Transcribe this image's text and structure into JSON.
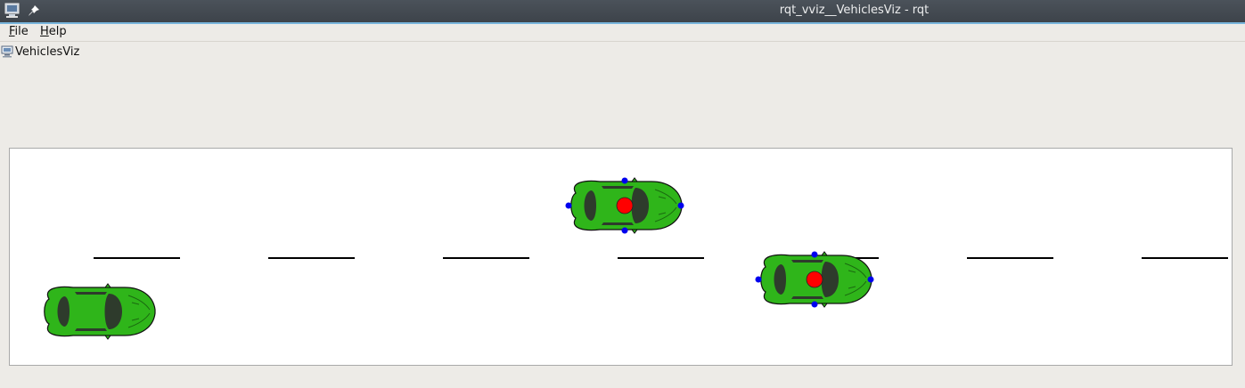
{
  "window": {
    "title": "rqt_vviz__VehiclesViz - rqt",
    "system_icon": "computer-icon",
    "pin_icon": "pin-icon"
  },
  "menu": {
    "items": [
      {
        "label": "File",
        "mnemonic": "F",
        "rest": "ile"
      },
      {
        "label": "Help",
        "mnemonic": "H",
        "rest": "elp"
      }
    ]
  },
  "plugin": {
    "title": "VehiclesViz",
    "icon": "computer-icon"
  },
  "scene": {
    "lane_marking_color": "#000000",
    "car_color": "#2fb51a",
    "car_outline_color": "#111111",
    "center_marker_color": "#ff0000",
    "corner_marker_color": "#0000ee",
    "vehicles": [
      {
        "id": "left-car",
        "markers": false
      },
      {
        "id": "top-car",
        "markers": true
      },
      {
        "id": "right-car",
        "markers": true
      }
    ]
  }
}
